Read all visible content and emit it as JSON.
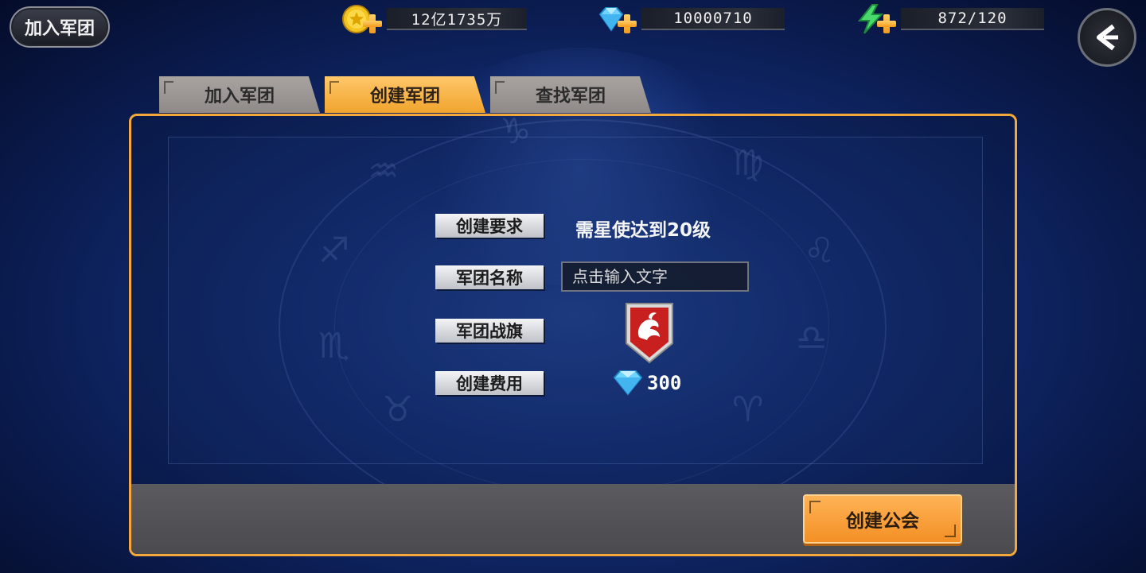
{
  "top": {
    "guild_button_label": "加入军团",
    "gold": {
      "icon": "gold-coin-icon",
      "value": "12亿1735万"
    },
    "diamond": {
      "icon": "diamond-icon",
      "value": "10000710"
    },
    "energy": {
      "icon": "lightning-icon",
      "value": "872/120"
    },
    "back_icon": "back-arrow-icon"
  },
  "tabs": [
    {
      "label": "加入军团",
      "active": false
    },
    {
      "label": "创建军团",
      "active": true
    },
    {
      "label": "查找军团",
      "active": false
    }
  ],
  "form": {
    "requirement_label": "创建要求",
    "requirement_value": "需星使达到20级",
    "name_label": "军团名称",
    "name_placeholder": "点击输入文字",
    "banner_label": "军团战旗",
    "banner_icon": "phoenix-banner-icon",
    "cost_label": "创建费用",
    "cost_icon": "diamond-icon",
    "cost_value": "300"
  },
  "create_button_label": "创建公会",
  "colors": {
    "accent_orange": "#f5a83a",
    "active_tab": "#f0a42e",
    "inactive_tab": "#a9a3a0",
    "banner_red": "#c8201f"
  }
}
